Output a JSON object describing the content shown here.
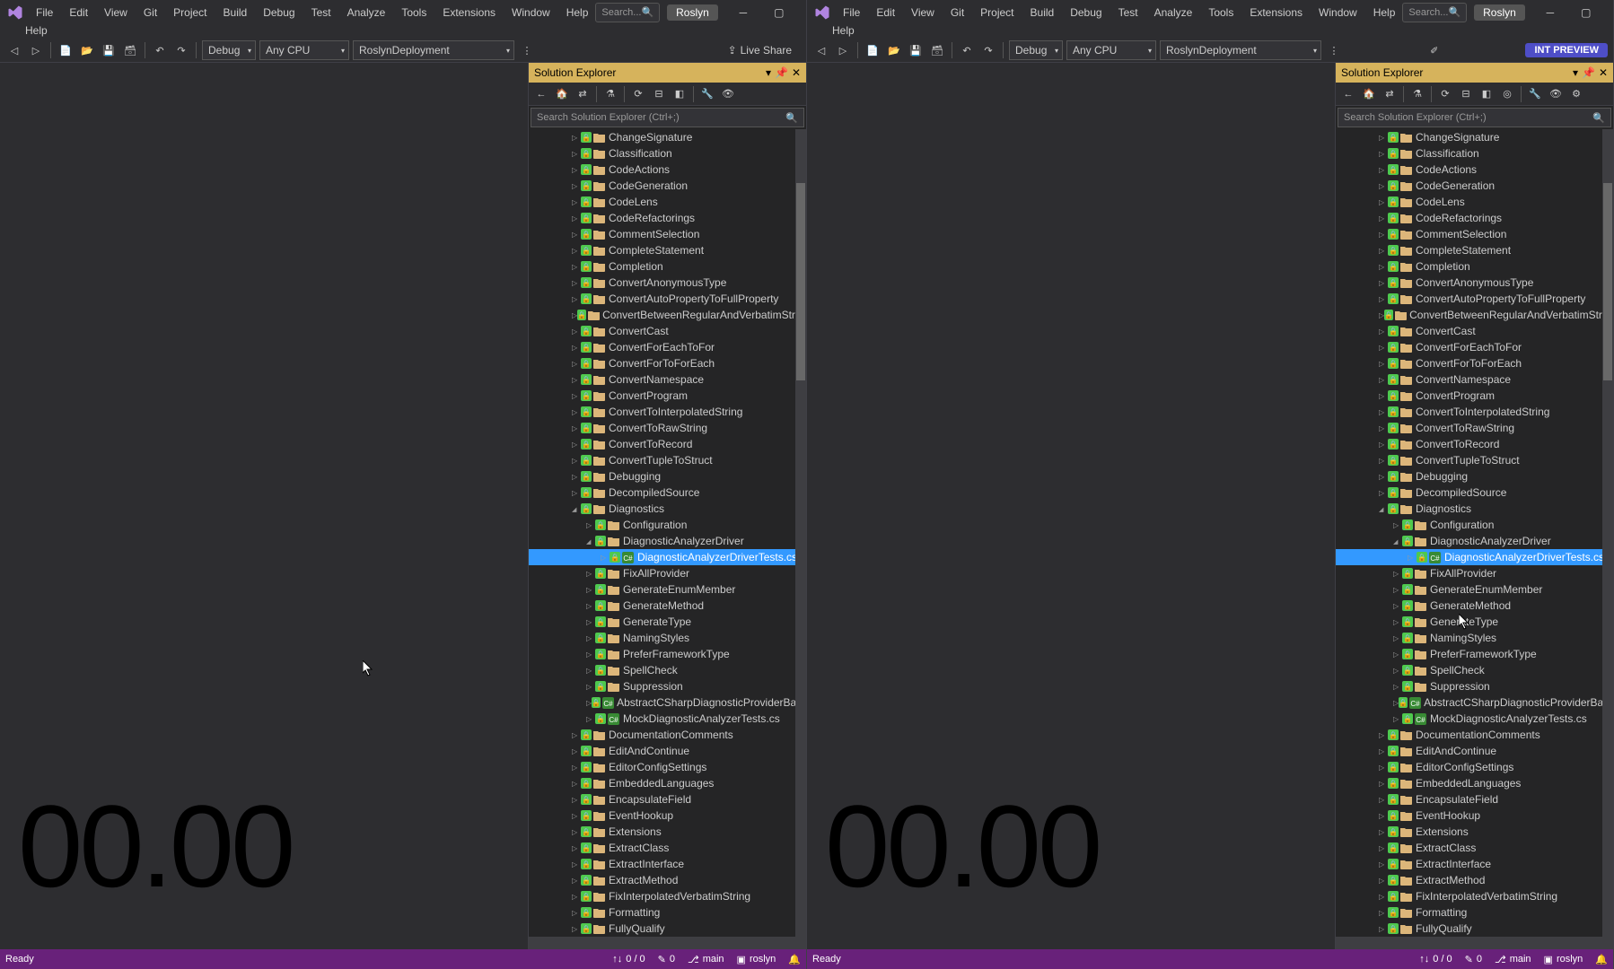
{
  "menu": [
    "File",
    "Edit",
    "View",
    "Git",
    "Project",
    "Build",
    "Debug",
    "Test",
    "Analyze",
    "Tools",
    "Extensions",
    "Window",
    "Help"
  ],
  "search_placeholder": "Search...",
  "solution_name": "Roslyn",
  "toolbar": {
    "config": "Debug",
    "platform": "Any CPU",
    "startup": "RoslynDeployment",
    "liveshare": "Live Share",
    "preview": "INT PREVIEW"
  },
  "solex": {
    "title": "Solution Explorer",
    "search": "Search Solution Explorer (Ctrl+;)",
    "selected": "DiagnosticAnalyzerDriverTests.cs",
    "items": [
      {
        "t": "f",
        "i": 3,
        "n": "ChangeSignature"
      },
      {
        "t": "f",
        "i": 3,
        "n": "Classification"
      },
      {
        "t": "f",
        "i": 3,
        "n": "CodeActions"
      },
      {
        "t": "f",
        "i": 3,
        "n": "CodeGeneration"
      },
      {
        "t": "f",
        "i": 3,
        "n": "CodeLens"
      },
      {
        "t": "f",
        "i": 3,
        "n": "CodeRefactorings"
      },
      {
        "t": "f",
        "i": 3,
        "n": "CommentSelection"
      },
      {
        "t": "f",
        "i": 3,
        "n": "CompleteStatement"
      },
      {
        "t": "f",
        "i": 3,
        "n": "Completion"
      },
      {
        "t": "f",
        "i": 3,
        "n": "ConvertAnonymousType"
      },
      {
        "t": "f",
        "i": 3,
        "n": "ConvertAutoPropertyToFullProperty"
      },
      {
        "t": "f",
        "i": 3,
        "n": "ConvertBetweenRegularAndVerbatimString"
      },
      {
        "t": "f",
        "i": 3,
        "n": "ConvertCast"
      },
      {
        "t": "f",
        "i": 3,
        "n": "ConvertForEachToFor"
      },
      {
        "t": "f",
        "i": 3,
        "n": "ConvertForToForEach"
      },
      {
        "t": "f",
        "i": 3,
        "n": "ConvertNamespace"
      },
      {
        "t": "f",
        "i": 3,
        "n": "ConvertProgram"
      },
      {
        "t": "f",
        "i": 3,
        "n": "ConvertToInterpolatedString"
      },
      {
        "t": "f",
        "i": 3,
        "n": "ConvertToRawString"
      },
      {
        "t": "f",
        "i": 3,
        "n": "ConvertToRecord"
      },
      {
        "t": "f",
        "i": 3,
        "n": "ConvertTupleToStruct"
      },
      {
        "t": "f",
        "i": 3,
        "n": "Debugging"
      },
      {
        "t": "f",
        "i": 3,
        "n": "DecompiledSource"
      },
      {
        "t": "f",
        "i": 3,
        "n": "Diagnostics",
        "open": true
      },
      {
        "t": "f",
        "i": 4,
        "n": "Configuration"
      },
      {
        "t": "f",
        "i": 4,
        "n": "DiagnosticAnalyzerDriver",
        "open": true
      },
      {
        "t": "cs",
        "i": 5,
        "n": "DiagnosticAnalyzerDriverTests.cs",
        "sel": true
      },
      {
        "t": "f",
        "i": 4,
        "n": "FixAllProvider"
      },
      {
        "t": "f",
        "i": 4,
        "n": "GenerateEnumMember"
      },
      {
        "t": "f",
        "i": 4,
        "n": "GenerateMethod"
      },
      {
        "t": "f",
        "i": 4,
        "n": "GenerateType"
      },
      {
        "t": "f",
        "i": 4,
        "n": "NamingStyles"
      },
      {
        "t": "f",
        "i": 4,
        "n": "PreferFrameworkType"
      },
      {
        "t": "f",
        "i": 4,
        "n": "SpellCheck"
      },
      {
        "t": "f",
        "i": 4,
        "n": "Suppression"
      },
      {
        "t": "cs",
        "i": 4,
        "n": "AbstractCSharpDiagnosticProviderBasedUserDiagnosticTest.cs"
      },
      {
        "t": "cs",
        "i": 4,
        "n": "MockDiagnosticAnalyzerTests.cs"
      },
      {
        "t": "f",
        "i": 3,
        "n": "DocumentationComments"
      },
      {
        "t": "f",
        "i": 3,
        "n": "EditAndContinue"
      },
      {
        "t": "f",
        "i": 3,
        "n": "EditorConfigSettings"
      },
      {
        "t": "f",
        "i": 3,
        "n": "EmbeddedLanguages"
      },
      {
        "t": "f",
        "i": 3,
        "n": "EncapsulateField"
      },
      {
        "t": "f",
        "i": 3,
        "n": "EventHookup"
      },
      {
        "t": "f",
        "i": 3,
        "n": "Extensions"
      },
      {
        "t": "f",
        "i": 3,
        "n": "ExtractClass"
      },
      {
        "t": "f",
        "i": 3,
        "n": "ExtractInterface"
      },
      {
        "t": "f",
        "i": 3,
        "n": "ExtractMethod"
      },
      {
        "t": "f",
        "i": 3,
        "n": "FixInterpolatedVerbatimString"
      },
      {
        "t": "f",
        "i": 3,
        "n": "Formatting"
      },
      {
        "t": "f",
        "i": 3,
        "n": "FullyQualify"
      }
    ]
  },
  "timer": "00.00",
  "status": {
    "ready": "Ready",
    "updown": "0 / 0",
    "edits": "0",
    "branch": "main",
    "repo": "roslyn"
  }
}
